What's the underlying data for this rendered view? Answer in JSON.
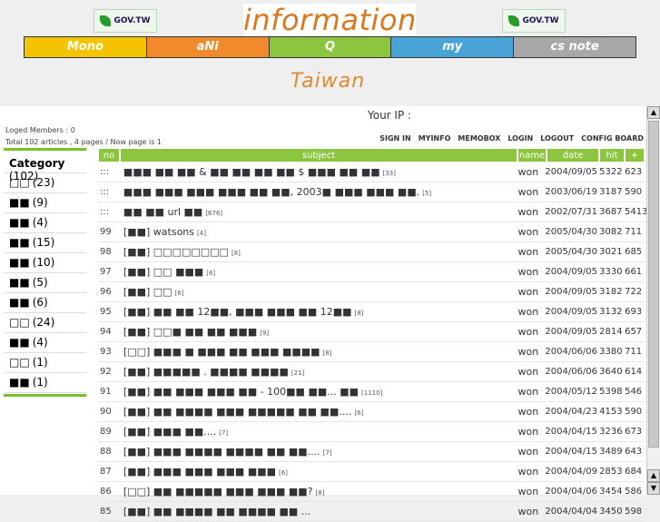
{
  "header": {
    "gov_badge_left": "GOV.TW",
    "gov_badge_right": "GOV.TW",
    "logo_text": "information",
    "subtitle": "Taiwan"
  },
  "nav": [
    {
      "label": "Mono",
      "color": "#f5c400"
    },
    {
      "label": "aNi",
      "color": "#f08a2a"
    },
    {
      "label": "Q",
      "color": "#8cc63f"
    },
    {
      "label": "my",
      "color": "#4aa3d6"
    },
    {
      "label": "cs note",
      "color": "#a8a8a8"
    }
  ],
  "board": {
    "ip_label": "Your IP :",
    "members_line": "Loged Members : 0",
    "totals_line": "Total  102  articles ,  4  pages / Now page is  1",
    "toolbar": [
      "SIGN IN",
      "MYINFO",
      "MEMOBOX",
      "LOGIN",
      "LOGOUT",
      "CONFIG BOARD"
    ],
    "columns": [
      "no",
      "subject",
      "name",
      "date",
      "hit",
      "+"
    ],
    "rows": [
      {
        "no": ":::",
        "subject": "■■■ ■■ ■■ & ■■ ■■ ■■ ■■ $ ■■■ ■■ ■■",
        "count": "[33]",
        "name": "won",
        "date": "2004/09/05",
        "hit": "5322",
        "rec": "623"
      },
      {
        "no": ":::",
        "subject": "■■■ ■■■ ■■■ ■■■ ■■ ■■, 2003■ ■■■ ■■■ ■■.",
        "count": "[5]",
        "name": "won",
        "date": "2003/06/19",
        "hit": "3187",
        "rec": "590"
      },
      {
        "no": ":::",
        "subject": "■■ ■■ url ■■",
        "count": "[676]",
        "name": "won",
        "date": "2002/07/31",
        "hit": "3687",
        "rec": "5413"
      },
      {
        "no": "99",
        "subject": "[■■] watsons",
        "count": "[4]",
        "name": "won",
        "date": "2005/04/30",
        "hit": "3082",
        "rec": "711"
      },
      {
        "no": "98",
        "subject": "[■■] □□□□□□□□",
        "count": "[8]",
        "name": "won",
        "date": "2005/04/30",
        "hit": "3021",
        "rec": "685"
      },
      {
        "no": "97",
        "subject": "[■■] □□ ■■■",
        "count": "[6]",
        "name": "won",
        "date": "2004/09/05",
        "hit": "3330",
        "rec": "661"
      },
      {
        "no": "96",
        "subject": "[■■] □□",
        "count": "[6]",
        "name": "won",
        "date": "2004/09/05",
        "hit": "3182",
        "rec": "722"
      },
      {
        "no": "95",
        "subject": "[■■] ■■ ■■ 12■■, ■■■ ■■■ ■■ 12■■",
        "count": "[8]",
        "name": "won",
        "date": "2004/09/05",
        "hit": "3132",
        "rec": "693"
      },
      {
        "no": "94",
        "subject": "[■■] □□■ ■■ ■■ ■■■",
        "count": "[9]",
        "name": "won",
        "date": "2004/09/05",
        "hit": "2814",
        "rec": "657"
      },
      {
        "no": "93",
        "subject": "[□□] ■■■ ■ ■■■ ■■ ■■■ ■■■■",
        "count": "[8]",
        "name": "won",
        "date": "2004/06/06",
        "hit": "3380",
        "rec": "711"
      },
      {
        "no": "92",
        "subject": "[■■] ■■■■■ . ■■■■ ■■■■",
        "count": "[21]",
        "name": "won",
        "date": "2004/06/06",
        "hit": "3640",
        "rec": "614"
      },
      {
        "no": "91",
        "subject": "[■■] ■■ ■■■ ■■■ ■■ - 100■■ ■■... ■■",
        "count": "[1110]",
        "name": "won",
        "date": "2004/05/12",
        "hit": "5398",
        "rec": "546"
      },
      {
        "no": "90",
        "subject": "[■■] ■■ ■■■■ ■■■ ■■■■■ ■■ ■■....",
        "count": "[6]",
        "name": "won",
        "date": "2004/04/23",
        "hit": "4153",
        "rec": "590"
      },
      {
        "no": "89",
        "subject": "[■■] ■■■ ■■....",
        "count": "[7]",
        "name": "won",
        "date": "2004/04/15",
        "hit": "3236",
        "rec": "673"
      },
      {
        "no": "88",
        "subject": "[■■] ■■■ ■■■■ ■■■■ ■■ ■■....",
        "count": "[7]",
        "name": "won",
        "date": "2004/04/15",
        "hit": "3489",
        "rec": "643"
      },
      {
        "no": "87",
        "subject": "[■■] ■■■ ■■■ ■■■ ■■■",
        "count": "[6]",
        "name": "won",
        "date": "2004/04/09",
        "hit": "2853",
        "rec": "684"
      },
      {
        "no": "86",
        "subject": "[□□] ■■ ■■■■■ ■■■ ■■■ ■■?",
        "count": "[8]",
        "name": "won",
        "date": "2004/04/06",
        "hit": "3454",
        "rec": "586"
      },
      {
        "no": "85",
        "subject": "[■■] ■■ ■■■■ ■■ ■■■■ ■■ ...",
        "count": "",
        "name": "won",
        "date": "2004/04/04",
        "hit": "3450",
        "rec": "598"
      }
    ]
  },
  "sidebar": {
    "heading": "Category",
    "heading_count": "(102)",
    "items": [
      {
        "label": "□□",
        "count": "(23)"
      },
      {
        "label": "■■",
        "count": "(9)"
      },
      {
        "label": "■■",
        "count": "(4)"
      },
      {
        "label": "■■",
        "count": "(15)"
      },
      {
        "label": "■■",
        "count": "(10)"
      },
      {
        "label": "■■",
        "count": "(5)"
      },
      {
        "label": "■■",
        "count": "(6)"
      },
      {
        "label": "□□",
        "count": "(24)"
      },
      {
        "label": "■■",
        "count": "(4)"
      },
      {
        "label": "□□",
        "count": "(1)"
      },
      {
        "label": "■■",
        "count": "(1)"
      }
    ]
  },
  "scrollbar": {
    "up": "▲",
    "down": "▼"
  }
}
